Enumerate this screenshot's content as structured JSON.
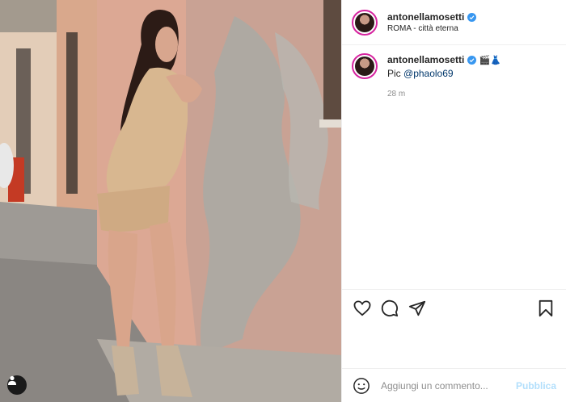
{
  "post": {
    "username": "antonellamosetti",
    "location": "ROMA - città eterna"
  },
  "caption": {
    "username": "antonellamosetti",
    "emojis": "🎬👗",
    "text_prefix": "Pic ",
    "mention": "@phaolo69",
    "time": "28 m"
  },
  "icons": {
    "like": "heart-icon",
    "comment": "comment-icon",
    "share": "paper-plane-icon",
    "save": "bookmark-icon",
    "emoji": "smiley-icon",
    "tag": "person-icon",
    "verified": "verified-badge-icon"
  },
  "comment_box": {
    "placeholder": "Aggiungi un commento...",
    "submit_label": "Pubblica"
  },
  "colors": {
    "verified": "#3897f0",
    "mention": "#00376b",
    "submit_disabled": "#b2dffc"
  }
}
